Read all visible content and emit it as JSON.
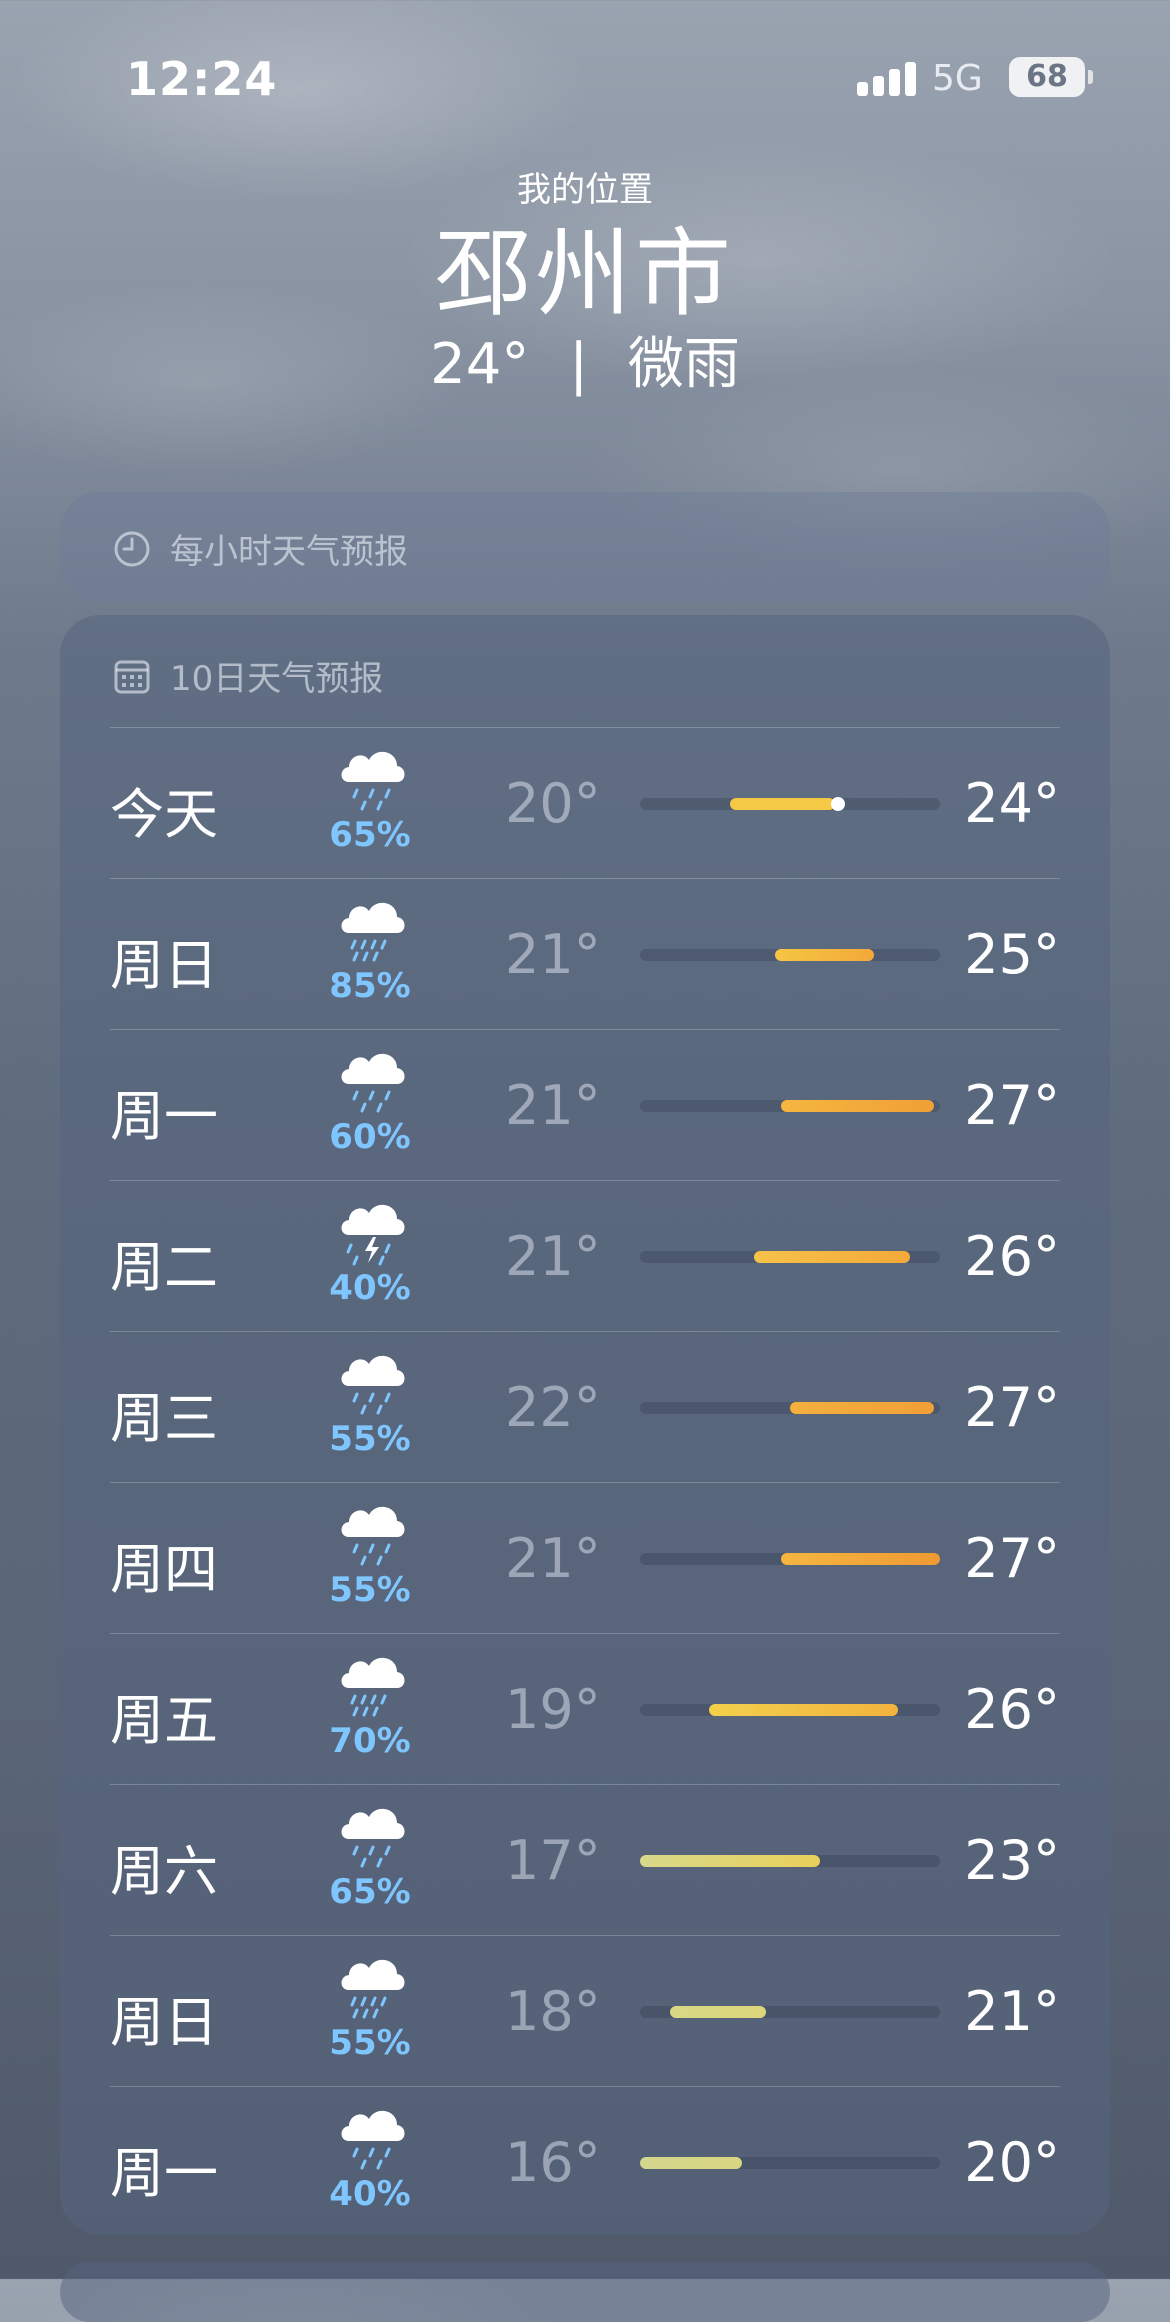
{
  "status_bar": {
    "time": "12:24",
    "network": "5G",
    "battery": "68"
  },
  "location": {
    "label": "我的位置",
    "city": "邳州市",
    "current_temp": "24°",
    "separator": "|",
    "condition": "微雨"
  },
  "hourly": {
    "title": "每小时天气预报",
    "icon": "clock-icon"
  },
  "daily": {
    "title": "10日天气预报",
    "icon": "calendar-icon",
    "days": [
      {
        "day": "今天",
        "icon": "cloud-rain-icon",
        "precip": "65%",
        "low": "20°",
        "high": "24°",
        "bar_start": 0.3,
        "bar_end": 0.65,
        "current": 0.66,
        "color_start": "#f4c945",
        "color_end": "#f4c945"
      },
      {
        "day": "周日",
        "icon": "cloud-heavy-rain-icon",
        "precip": "85%",
        "low": "21°",
        "high": "25°",
        "bar_start": 0.45,
        "bar_end": 0.78,
        "color_start": "#f5c542",
        "color_end": "#f3a93a"
      },
      {
        "day": "周一",
        "icon": "cloud-rain-icon",
        "precip": "60%",
        "low": "21°",
        "high": "27°",
        "bar_start": 0.47,
        "bar_end": 0.98,
        "color_start": "#f5b640",
        "color_end": "#f0a035"
      },
      {
        "day": "周二",
        "icon": "cloud-lightning-rain-icon",
        "precip": "40%",
        "low": "21°",
        "high": "26°",
        "bar_start": 0.38,
        "bar_end": 0.9,
        "color_start": "#f6c24a",
        "color_end": "#f3a93a"
      },
      {
        "day": "周三",
        "icon": "cloud-rain-icon",
        "precip": "55%",
        "low": "22°",
        "high": "27°",
        "bar_start": 0.5,
        "bar_end": 0.98,
        "color_start": "#f4b03d",
        "color_end": "#f0a035"
      },
      {
        "day": "周四",
        "icon": "cloud-rain-icon",
        "precip": "55%",
        "low": "21°",
        "high": "27°",
        "bar_start": 0.47,
        "bar_end": 1.0,
        "color_start": "#f5b640",
        "color_end": "#ef9a33"
      },
      {
        "day": "周五",
        "icon": "cloud-heavy-rain-icon",
        "precip": "70%",
        "low": "19°",
        "high": "26°",
        "bar_start": 0.23,
        "bar_end": 0.86,
        "color_start": "#f3d04c",
        "color_end": "#f2b33d"
      },
      {
        "day": "周六",
        "icon": "cloud-rain-icon",
        "precip": "65%",
        "low": "17°",
        "high": "23°",
        "bar_start": 0.0,
        "bar_end": 0.6,
        "color_start": "#d8d98a",
        "color_end": "#e9cf5a"
      },
      {
        "day": "周日",
        "icon": "cloud-heavy-rain-icon",
        "precip": "55%",
        "low": "18°",
        "high": "21°",
        "bar_start": 0.1,
        "bar_end": 0.42,
        "color_start": "#d9d985",
        "color_end": "#dcd67c"
      },
      {
        "day": "周一",
        "icon": "cloud-rain-icon",
        "precip": "40%",
        "low": "16°",
        "high": "20°",
        "bar_start": 0.0,
        "bar_end": 0.34,
        "color_start": "#d3d68c",
        "color_end": "#d9d582"
      }
    ]
  }
}
